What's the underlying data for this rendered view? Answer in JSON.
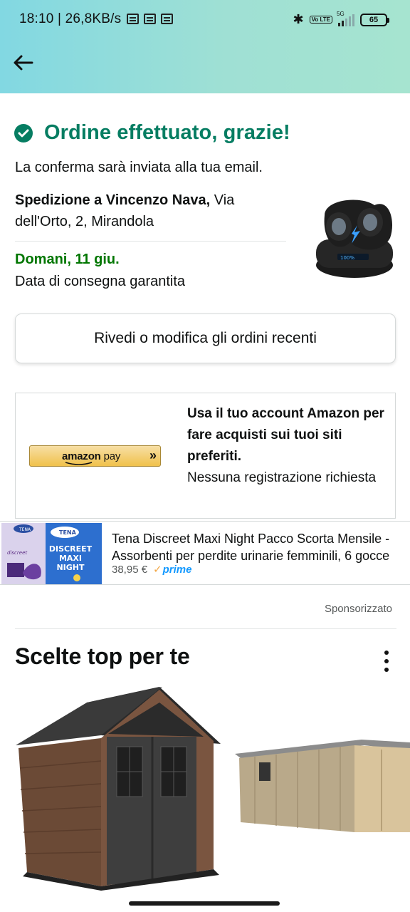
{
  "status_bar": {
    "time_speed": "18:10 | 26,8KB/s",
    "volte": "Vo LTE",
    "signal_label": "5G",
    "battery": "65"
  },
  "icons": {
    "back": "arrow-left-icon",
    "check": "check-circle-icon",
    "more": "more-vertical-icon"
  },
  "confirmation": {
    "title": "Ordine effettuato, grazie!",
    "subtitle": "La conferma sarà inviata alla tua email.",
    "ship_label": "Spedizione a Vincenzo Nava,",
    "ship_address": " Via dell'Orto, 2, Mirandola",
    "delivery_date": "Domani, 11 giu.",
    "delivery_note": "Data di consegna garantita"
  },
  "review_button": "Rivedi o modifica gli ordini recenti",
  "amazon_pay": {
    "logo_amazon": "amazon",
    "logo_pay": "pay",
    "chevron": "»",
    "headline": "Usa il tuo account Amazon per fare acquisti sui tuoi siti preferiti.",
    "subtext": "Nessuna registrazione richiesta"
  },
  "ad": {
    "brand": "TENA",
    "product_line1": "DISCREET",
    "product_line2": "MAXI",
    "product_line3": "NIGHT",
    "title": "Tena Discreet Maxi Night Pacco Scorta Mensile - Assorbenti per perdite urinarie femminili, 6 gocce",
    "price": "38,95 €",
    "prime_label": "prime"
  },
  "sponsored_label": "Sponsorizzato",
  "top_picks": {
    "title": "Scelte top per te"
  },
  "colors": {
    "success_green": "#067d62",
    "delivery_green": "#007600",
    "header_gradient_start": "#82d8e2",
    "header_gradient_end": "#a6e4d0",
    "prime_blue": "#1399ff",
    "amazon_pay_gold": "#f0c14b"
  }
}
